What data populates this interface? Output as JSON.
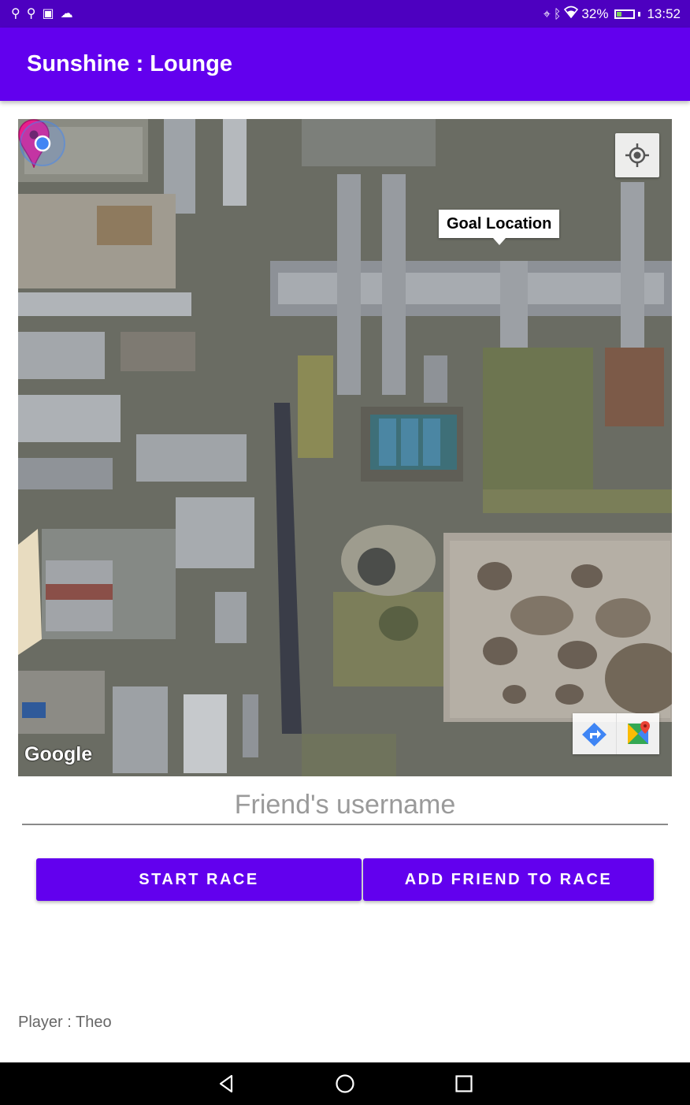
{
  "status_bar": {
    "left_icons": [
      "usb-icon",
      "usb-icon",
      "storage-icon",
      "cloud-icon"
    ],
    "right_icons": [
      "location-icon",
      "bluetooth-icon",
      "wifi-icon"
    ],
    "battery_percent": "32%",
    "battery_level": 0.32,
    "time": "13:52"
  },
  "app_bar": {
    "title": "Sunshine : Lounge"
  },
  "map": {
    "goal_tooltip": "Goal Location",
    "attribution": "Google",
    "pin_color": "#e91e8c",
    "my_location_color": "#4285f4",
    "icons": [
      "my-location-icon",
      "directions-icon",
      "google-maps-icon"
    ]
  },
  "form": {
    "username_placeholder": "Friend's username",
    "username_value": ""
  },
  "buttons": {
    "start_race": "START RACE",
    "add_friend": "ADD FRIEND TO RACE"
  },
  "footer": {
    "player_label": "Player : Theo"
  },
  "colors": {
    "status_bar": "#4d00c0",
    "primary": "#6200ee"
  },
  "nav_bar": {
    "icons": [
      "back-icon",
      "home-icon",
      "recents-icon"
    ]
  }
}
